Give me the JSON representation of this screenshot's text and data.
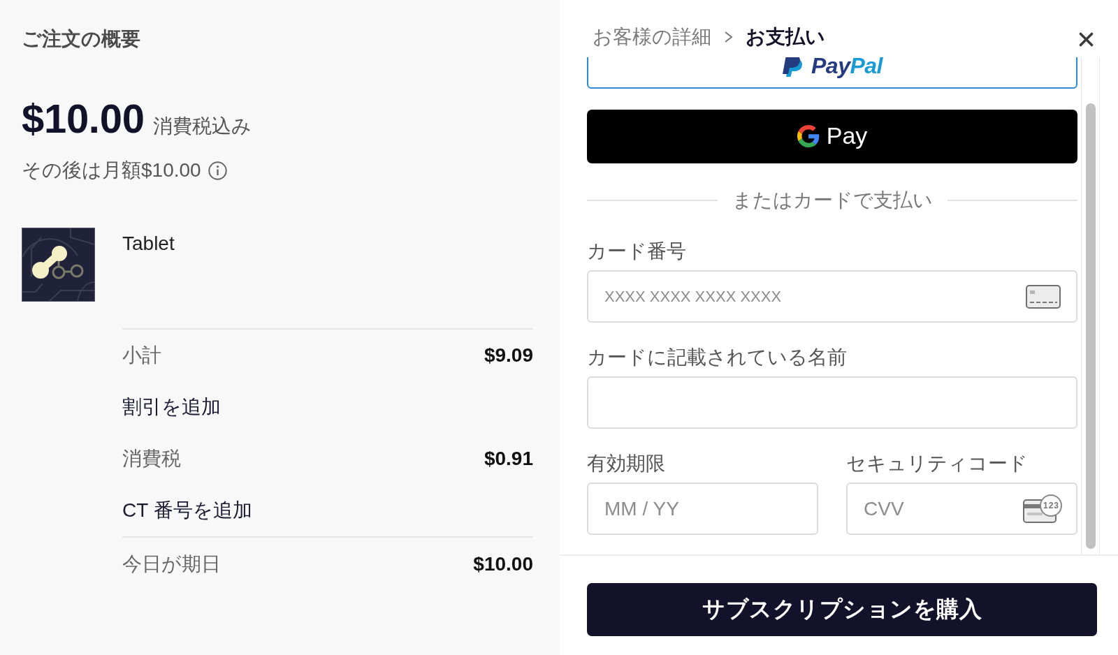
{
  "order_summary": {
    "title": "ご注文の概要",
    "price": "$10.00",
    "price_note": "消費税込み",
    "recurring_note": "その後は月額$10.00",
    "product": {
      "name": "Tablet"
    },
    "lines": [
      {
        "kind": "amount",
        "label": "小計",
        "value": "$9.09"
      },
      {
        "kind": "link",
        "label": "割引を追加"
      },
      {
        "kind": "amount",
        "label": "消費税",
        "value": "$0.91"
      },
      {
        "kind": "link",
        "label": "CT 番号を追加"
      }
    ],
    "total": {
      "label": "今日が期日",
      "value": "$10.00"
    }
  },
  "checkout": {
    "breadcrumb": [
      {
        "label": "お客様の詳細",
        "selected": false
      },
      {
        "label": "お支払い",
        "selected": true
      }
    ],
    "paypal_button": {
      "wordmark": [
        "Pay",
        "Pal"
      ]
    },
    "gpay_button": {
      "label": "Pay"
    },
    "separator": "またはカードで支払い",
    "field_rows": [
      {
        "fields": [
          {
            "kind": "card_number",
            "label": "カード番号",
            "placeholder": "XXXX XXXX XXXX XXXX"
          }
        ]
      },
      {
        "fields": [
          {
            "kind": "name",
            "label": "カードに記載されている名前"
          }
        ]
      },
      {
        "fields": [
          {
            "kind": "expiry",
            "label": "有効期限",
            "placeholder": "MM / YY"
          },
          {
            "kind": "cvv",
            "label": "セキュリティコード",
            "placeholder": "CVV",
            "badge": "123"
          }
        ]
      }
    ],
    "submit_button": {
      "label": "サブスクリプションを購入"
    }
  }
}
